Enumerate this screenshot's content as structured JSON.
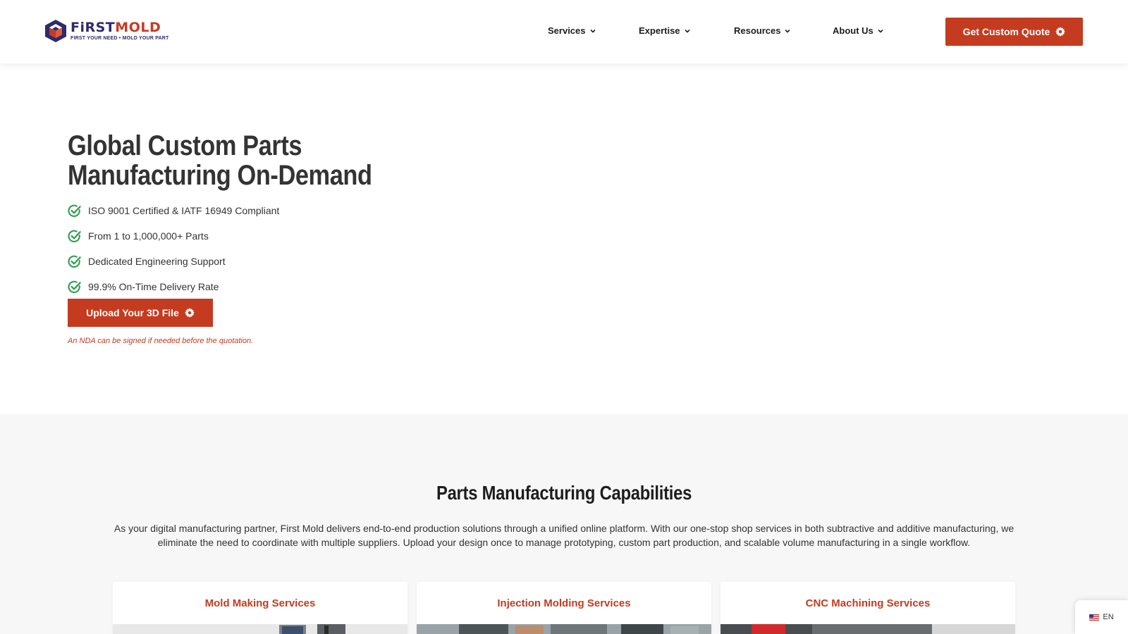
{
  "brand": {
    "name_first": "FiRST",
    "name_mold": "MOLD",
    "tagline": "FIRST YOUR NEED • MOLD YOUR PART",
    "color_navy": "#2f2a6b",
    "color_red": "#c73a22"
  },
  "nav": {
    "items": [
      {
        "label": "Services"
      },
      {
        "label": "Expertise"
      },
      {
        "label": "Resources"
      },
      {
        "label": "About Us"
      }
    ],
    "quote_button": "Get Custom Quote"
  },
  "hero": {
    "title": "Global Custom Parts Manufacturing On-Demand",
    "checks": [
      "ISO 9001 Certified & IATF 16949 Compliant",
      "From 1 to 1,000,000+ Parts",
      "Dedicated Engineering Support",
      "99.9% On-Time Delivery Rate"
    ],
    "upload_button": "Upload Your 3D File",
    "nda_note": "An NDA can be signed if needed before the quotation."
  },
  "capabilities": {
    "title": "Parts Manufacturing Capabilities",
    "description": "As your digital manufacturing partner, First Mold delivers end-to-end production solutions through a unified online platform. With our one-stop shop services in both subtractive and additive manufacturing, we eliminate the need to coordinate with multiple suppliers. Upload your design once to manage prototyping, custom part production, and scalable volume manufacturing in a single workflow.",
    "cards": [
      {
        "title": "Mold Making Services"
      },
      {
        "title": "Injection Molding Services"
      },
      {
        "title": "CNC Machining Services"
      }
    ]
  },
  "language": {
    "code": "EN",
    "icon": "us-flag-icon"
  },
  "colors": {
    "accent": "#c53b1f",
    "check_green": "#2e9e4f",
    "section_bg": "#f7f7f7"
  }
}
